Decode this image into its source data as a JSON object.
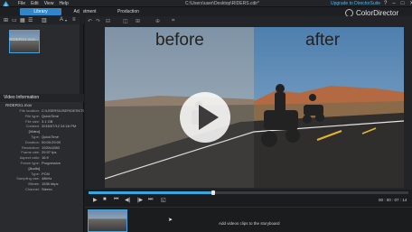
{
  "titlebar": {
    "menu": [
      "File",
      "Edit",
      "View",
      "Help"
    ],
    "file_path": "C:\\Users\\user\\Desktop\\RIDERS.cdir*",
    "upgrade_link": "Upgrade to DirectorSuite",
    "window_buttons": [
      "?",
      "–",
      "□",
      "✕"
    ]
  },
  "tabs": [
    {
      "label": "Library",
      "active": true
    },
    {
      "label": "Adjustment",
      "active": false
    },
    {
      "label": "Production",
      "active": false
    }
  ],
  "brand": {
    "name": "ColorDirector"
  },
  "library": {
    "filter_label": "A",
    "items": [
      {
        "label": "RIDERS1.mov"
      }
    ]
  },
  "video_info": {
    "header": "Video Information",
    "file_name": "RIDERS1.mov",
    "rows": [
      {
        "k": "File location:",
        "v": "C:\\USERS\\USER\\DESKTOP\\RID..."
      },
      {
        "k": "File type:",
        "v": "QuickTime"
      },
      {
        "k": "File size:",
        "v": "3.1 GB"
      },
      {
        "k": "Created:",
        "v": "2016/07/12 04:16 PM"
      },
      {
        "k": "[Video]",
        "v": ""
      },
      {
        "k": "Type:",
        "v": "QuickTime"
      },
      {
        "k": "Duration:",
        "v": "00:00:29:00"
      },
      {
        "k": "Resolution:",
        "v": "1920x1080"
      },
      {
        "k": "Frame rate:",
        "v": "29.97 fps"
      },
      {
        "k": "Aspect ratio:",
        "v": "16:9"
      },
      {
        "k": "Frame type:",
        "v": "Progressive"
      },
      {
        "k": "[Audio]",
        "v": ""
      },
      {
        "k": "Type:",
        "v": "PCM"
      },
      {
        "k": "Sampling rate:",
        "v": "48kHz"
      },
      {
        "k": "Bitrate:",
        "v": "1536 kbps"
      },
      {
        "k": "Channel:",
        "v": "Stereo"
      }
    ]
  },
  "preview": {
    "before_label": "before",
    "after_label": "after"
  },
  "playback": {
    "progress": 0.39,
    "timecode": "00 : 00 : 07 : 14"
  },
  "storyboard": {
    "hint": "Add videos clips to the storyboard"
  },
  "colors": {
    "accent": "#2f86c8",
    "link": "#4fb4ea",
    "background": "#1b1c1e"
  }
}
